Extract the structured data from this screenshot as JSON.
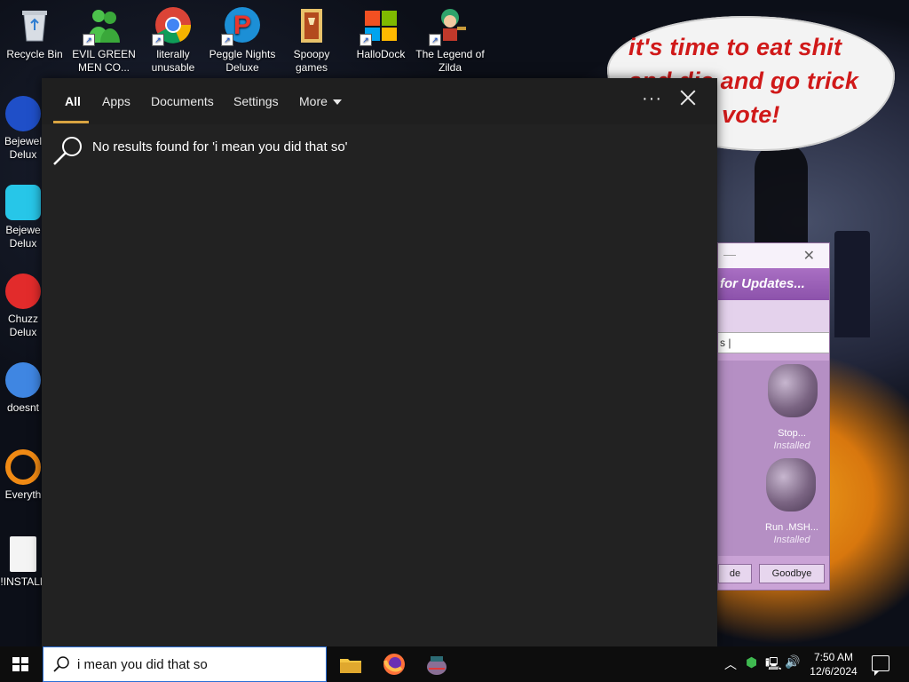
{
  "desktop": {
    "top_icons": [
      {
        "label": "Recycle Bin",
        "icon": "recycle-bin-icon"
      },
      {
        "label": "EVIL GREEN MEN CO...",
        "icon": "green-people-icon"
      },
      {
        "label": "literally unusable",
        "icon": "chrome-icon"
      },
      {
        "label": "Peggle Nights Deluxe",
        "icon": "peggle-icon"
      },
      {
        "label": "Spoopy games",
        "icon": "folder-icon"
      },
      {
        "label": "HalloDock",
        "icon": "windows-logo-icon"
      },
      {
        "label": "The Legend of Zilda",
        "icon": "game-character-icon"
      }
    ],
    "left_icons": [
      {
        "label": "Bejewel Delux",
        "icon": "bejeweled-2-icon"
      },
      {
        "label": "Bejewe Delux",
        "icon": "diamond-icon"
      },
      {
        "label": "Chuzz Delux",
        "icon": "chuzzle-icon"
      },
      {
        "label": "doesnt",
        "icon": "thunderbird-icon"
      },
      {
        "label": "Everyth",
        "icon": "everything-search-icon"
      },
      {
        "label": "!INSTALL",
        "icon": "text-file-icon"
      }
    ],
    "wallpaper_text": "it's time to eat shit and die and go trick ing and vote!"
  },
  "updater": {
    "banner": "for Updates...",
    "address_fragment": "s |",
    "items": [
      {
        "label": "Stop...",
        "status": "Installed"
      },
      {
        "label": "Run .MSH...",
        "status": "Installed"
      }
    ],
    "buttons": {
      "left": "de",
      "goodbye": "Goodbye"
    }
  },
  "search": {
    "tabs": [
      "All",
      "Apps",
      "Documents",
      "Settings",
      "More"
    ],
    "active_tab": "All",
    "more_options": "···",
    "no_results": "No results found for 'i mean you did that so'",
    "query": "i mean you did that so"
  },
  "taskbar": {
    "apps": [
      "file-explorer-icon",
      "firefox-icon",
      "bonzi-pot-icon"
    ],
    "time": "7:50 AM",
    "date": "12/6/2024"
  },
  "colors": {
    "accent": "#d9a441",
    "flyout_bg": "#222222",
    "bubble_text": "#d01919"
  }
}
